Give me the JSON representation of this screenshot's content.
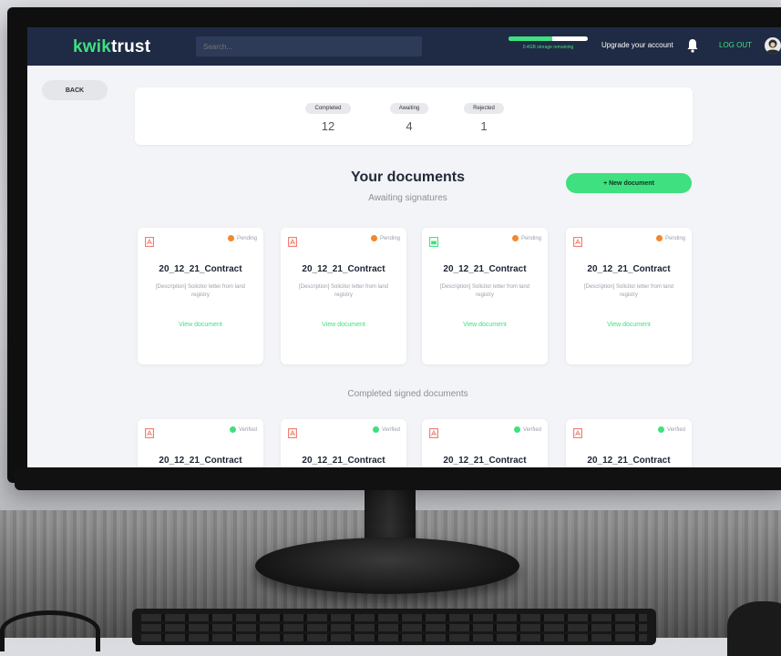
{
  "app": {
    "logo_part1": "kwik",
    "logo_part2": "trust",
    "search_placeholder": "Search...",
    "storage_label": "0.4GB storage remaining",
    "storage_fraction": 0.55,
    "upgrade_label": "Upgrade your account",
    "logout_label": "LOG OUT",
    "back_label": "BACK"
  },
  "stats": [
    {
      "label": "Completed",
      "value": "12"
    },
    {
      "label": "Awaiting",
      "value": "4"
    },
    {
      "label": "Rejected",
      "value": "1"
    }
  ],
  "main": {
    "title": "Your documents",
    "awaiting_title": "Awaiting signatures",
    "new_button": "+ New document",
    "completed_title": "Completed signed documents"
  },
  "awaiting_cards": [
    {
      "icon": "pdf-icon",
      "status": "Pending",
      "title": "20_12_21_Contract",
      "desc": "[Description] Solicitor letter from land registry",
      "link": "View document"
    },
    {
      "icon": "pdf-icon",
      "status": "Pending",
      "title": "20_12_21_Contract",
      "desc": "[Description] Solicitor letter from land registry",
      "link": "View document"
    },
    {
      "icon": "image-file-icon",
      "status": "Pending",
      "title": "20_12_21_Contract",
      "desc": "[Description] Solicitor letter from land registry",
      "link": "View document"
    },
    {
      "icon": "pdf-icon",
      "status": "Pending",
      "title": "20_12_21_Contract",
      "desc": "[Description] Solicitor letter from land registry",
      "link": "View document"
    }
  ],
  "completed_cards": [
    {
      "icon": "pdf-icon",
      "status": "Verified",
      "title": "20_12_21_Contract"
    },
    {
      "icon": "pdf-icon",
      "status": "Verified",
      "title": "20_12_21_Contract"
    },
    {
      "icon": "pdf-icon",
      "status": "Verified",
      "title": "20_12_21_Contract"
    },
    {
      "icon": "pdf-icon",
      "status": "Verified",
      "title": "20_12_21_Contract"
    }
  ],
  "colors": {
    "brand_green": "#3ee07f",
    "nav_bg": "#1f2a44",
    "pending": "#f5862b",
    "verified": "#3ee07f",
    "pdf_red": "#f07a6a",
    "image_green": "#3ee07f"
  }
}
